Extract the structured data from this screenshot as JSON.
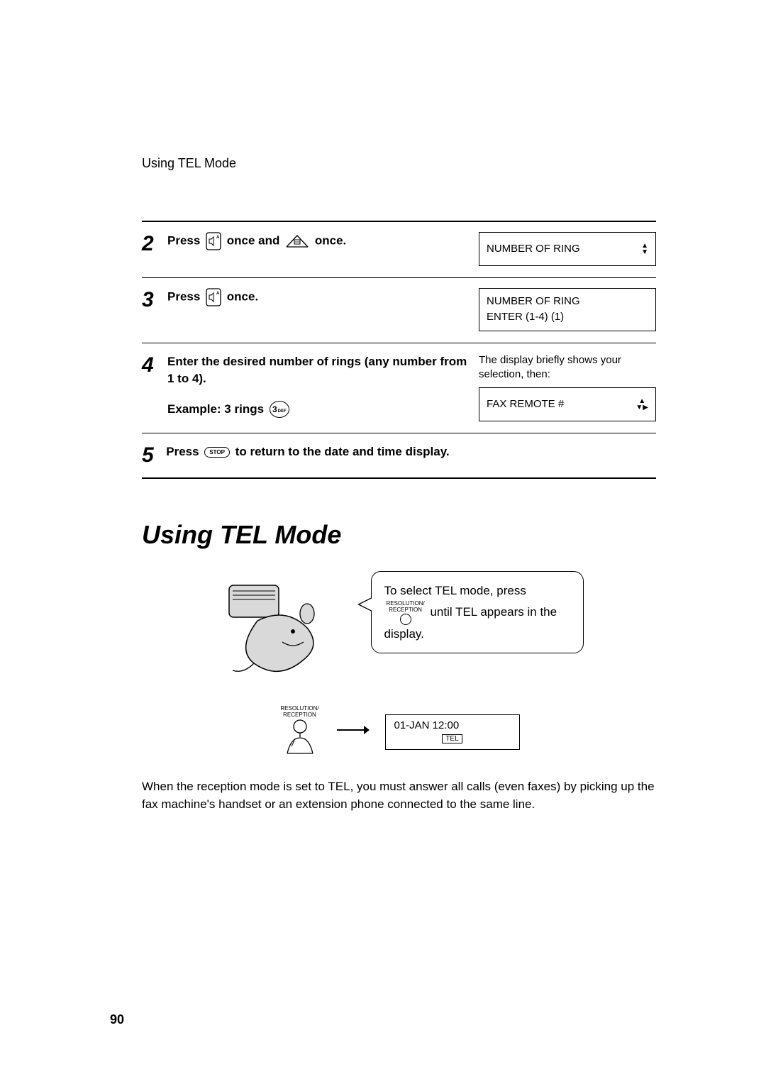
{
  "running_head": "Using TEL Mode",
  "steps": [
    {
      "num": "2",
      "text_before": "Press ",
      "text_mid": " once and ",
      "text_after": " once.",
      "lcd": {
        "line1": "NUMBER OF RING",
        "arrows": "ud"
      }
    },
    {
      "num": "3",
      "text_before": "Press ",
      "text_after": " once.",
      "lcd": {
        "line1": "NUMBER OF RING",
        "line2": "ENTER (1-4) (1)"
      }
    },
    {
      "num": "4",
      "line1": "Enter the desired number of rings (any number from 1 to 4).",
      "example_label": "Example: 3 rings",
      "digit": "3",
      "digit_sub": "DEF",
      "rnote": "The display briefly shows your selection, then:",
      "lcd": {
        "line1": "FAX REMOTE #",
        "arrows": "lr"
      }
    },
    {
      "num": "5",
      "text_before": "Press ",
      "stop_label": "STOP",
      "text_after": " to return to the date and time display."
    }
  ],
  "heading": "Using TEL Mode",
  "bubble": {
    "before": "To select TEL mode, press ",
    "btn_label1": "RESOLUTION/",
    "btn_label2": "RECEPTION",
    "mid": " until TEL appears in the display."
  },
  "hand_label1": "RESOLUTION/",
  "hand_label2": "RECEPTION",
  "mode_lcd": {
    "line1": "01-JAN  12:00",
    "tag": "TEL"
  },
  "body": "When the reception mode is set to TEL, you must answer all calls (even faxes) by picking up the fax machine's handset or an extension phone connected to the same line.",
  "page_number": "90"
}
